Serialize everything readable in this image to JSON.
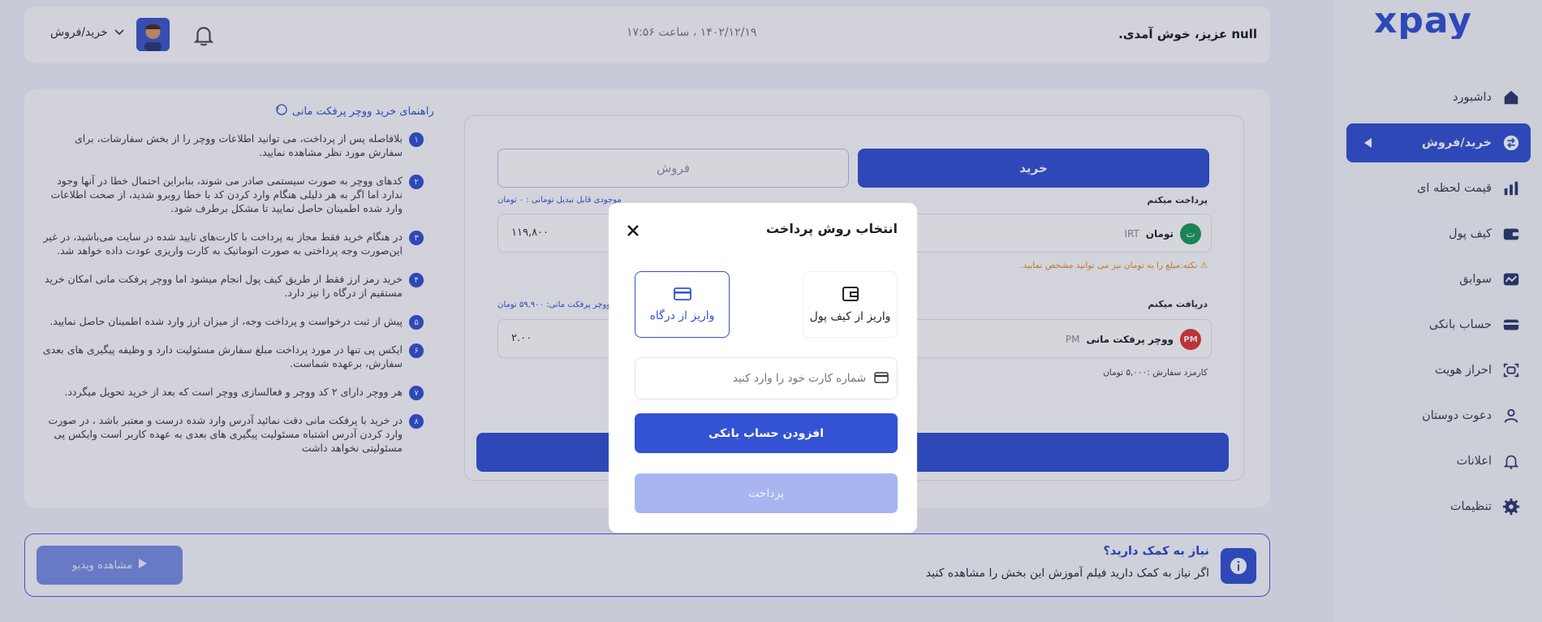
{
  "brand": {
    "logo_text": "xpay",
    "accent": "#3452d4"
  },
  "sidebar": {
    "items": [
      {
        "label": "داشبورد",
        "icon": "home-icon",
        "active": false
      },
      {
        "label": "خرید/فروش",
        "icon": "swap-icon",
        "active": true
      },
      {
        "label": "قیمت لحظه ای",
        "icon": "chart-icon",
        "active": false
      },
      {
        "label": "کیف پول",
        "icon": "wallet-icon",
        "active": false
      },
      {
        "label": "سوابق",
        "icon": "history-icon",
        "active": false
      },
      {
        "label": "حساب بانکی",
        "icon": "card-icon",
        "active": false
      },
      {
        "label": "احراز هویت",
        "icon": "id-scan-icon",
        "active": false
      },
      {
        "label": "دعوت دوستان",
        "icon": "user-icon",
        "active": false
      },
      {
        "label": "اعلانات",
        "icon": "bell-icon",
        "active": false
      },
      {
        "label": "تنظیمات",
        "icon": "gear-icon",
        "active": false
      }
    ]
  },
  "header": {
    "greeting": "null عزیز، خوش آمدی.",
    "datetime": "۱۴۰۲/۱۲/۱۹ ، ساعت ۱۷:۵۶",
    "mode_select": "خرید/فروش"
  },
  "guide": {
    "title": "راهنمای خرید ووچر پرفکت مانی",
    "items": [
      {
        "num": "۱",
        "text": "بلافاصله پس از پرداخت، می توانید اطلاعات ووچر را از بخش سفارشات، برای سفارش مورد نظر مشاهده نمایید."
      },
      {
        "num": "۲",
        "text": "کدهای ووچر به صورت سیستمی صادر می شوند، بنابراین احتمال خطا در آنها وجود ندارد اما اگر به هر دلیلی هنگام وارد کردن کد با خطا روبرو شدید، از صحت اطلاعات وارد شده اطمینان حاصل نمایید تا مشکل برطرف شود."
      },
      {
        "num": "۳",
        "text": "در هنگام خرید فقط مجاز به پرداخت با کارت‌های تایید شده در سایت می‌باشید، در غیر این‌صورت وجه پرداختی به صورت اتوماتیک به کارت واریزی عودت داده خواهد شد."
      },
      {
        "num": "۴",
        "text": "خرید رمز ارز فقط از طریق کیف پول انجام میشود اما ووچر پرفکت مانی امکان خرید مستقیم از درگاه را نیز دارد."
      },
      {
        "num": "۵",
        "text": "پیش از ثبت درخواست و پرداخت وجه، از میزان ارز وارد شده اطمینان حاصل نمایید."
      },
      {
        "num": "۶",
        "text": "ایکس پی تنها در مورد پرداخت مبلغ سفارش مسئولیت دارد و وظیفه پیگیری های بعدی سفارش، برعهده شماست."
      },
      {
        "num": "۷",
        "text": "هر ووچر دارای ۲ کد ووچر و فعالسازی ووچر است که بعد از خرید تحویل میگردد."
      },
      {
        "num": "۸",
        "text": "در خرید با پرفکت مانی دقت نمائید آدرس وارد شده درست و معتبر باشد ، در صورت وارد کردن آدرس اشتباه مسئولیت پیگیری های بعدی به عهده کاربر است وایکس پی مسئولیتی نخواهد داشت"
      }
    ]
  },
  "trade": {
    "tab_buy": "خرید",
    "tab_sell": "فروش",
    "pay_label": "پرداخت میکنم",
    "balance_label": "موجودی قابل تبدیل تومانی : ۰ تومان",
    "pay_currency_name": "تومان",
    "pay_currency_code": "IRT",
    "pay_currency_symbol": "ت",
    "pay_value": "۱۱۹,۸۰۰",
    "warning": "نکته:مبلغ را به تومان نیز می توانید مشخص نمایید.",
    "receive_label": "دریافت میکنم",
    "rate_label": "هر ووچر پرفکت مانی: ۵۹,۹۰۰ تومان",
    "receive_currency_name": "ووچر پرفکت مانی",
    "receive_currency_code": "PM",
    "receive_currency_badge": "PM",
    "receive_value": "۲.۰۰",
    "fee": "کارمزد سفارش :۵,۰۰۰ تومان"
  },
  "help": {
    "title": "نیاز به کمک دارید؟",
    "description": "اگر نیاز به کمک دارید فیلم آموزش این بخش را مشاهده کنید",
    "video_button": "مشاهده ویدیو"
  },
  "modal": {
    "title": "انتخاب روش پرداخت",
    "option_wallet": "واریز از کیف پول",
    "option_gateway": "واریز از درگاه",
    "card_placeholder": "شماره کارت خود را وارد کنید",
    "add_bank_button": "افزودن حساب بانکی",
    "pay_button": "پرداخت"
  }
}
